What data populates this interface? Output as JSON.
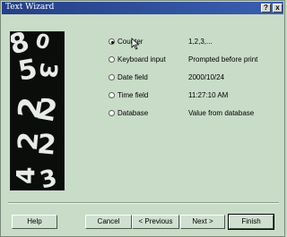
{
  "window": {
    "title": "Text Wizard",
    "help_glyph": "?",
    "close_glyph": "x"
  },
  "picture": {
    "icon": "digits-image"
  },
  "options": [
    {
      "label": "Counter",
      "value": "1,2,3,...",
      "checked": true
    },
    {
      "label": "Keyboard input",
      "value": "Prompted before print",
      "checked": false
    },
    {
      "label": "Date field",
      "value": "2000/10/24",
      "checked": false
    },
    {
      "label": "Time field",
      "value": "11:27:10 AM",
      "checked": false
    },
    {
      "label": "Database",
      "value": "Value from database",
      "checked": false
    }
  ],
  "buttons": {
    "help": "Help",
    "cancel": "Cancel",
    "previous": "< Previous",
    "next": "Next >",
    "finish": "Finish"
  },
  "colors": {
    "titlebar": "#253f86",
    "dialog": "#c8dcc8"
  }
}
